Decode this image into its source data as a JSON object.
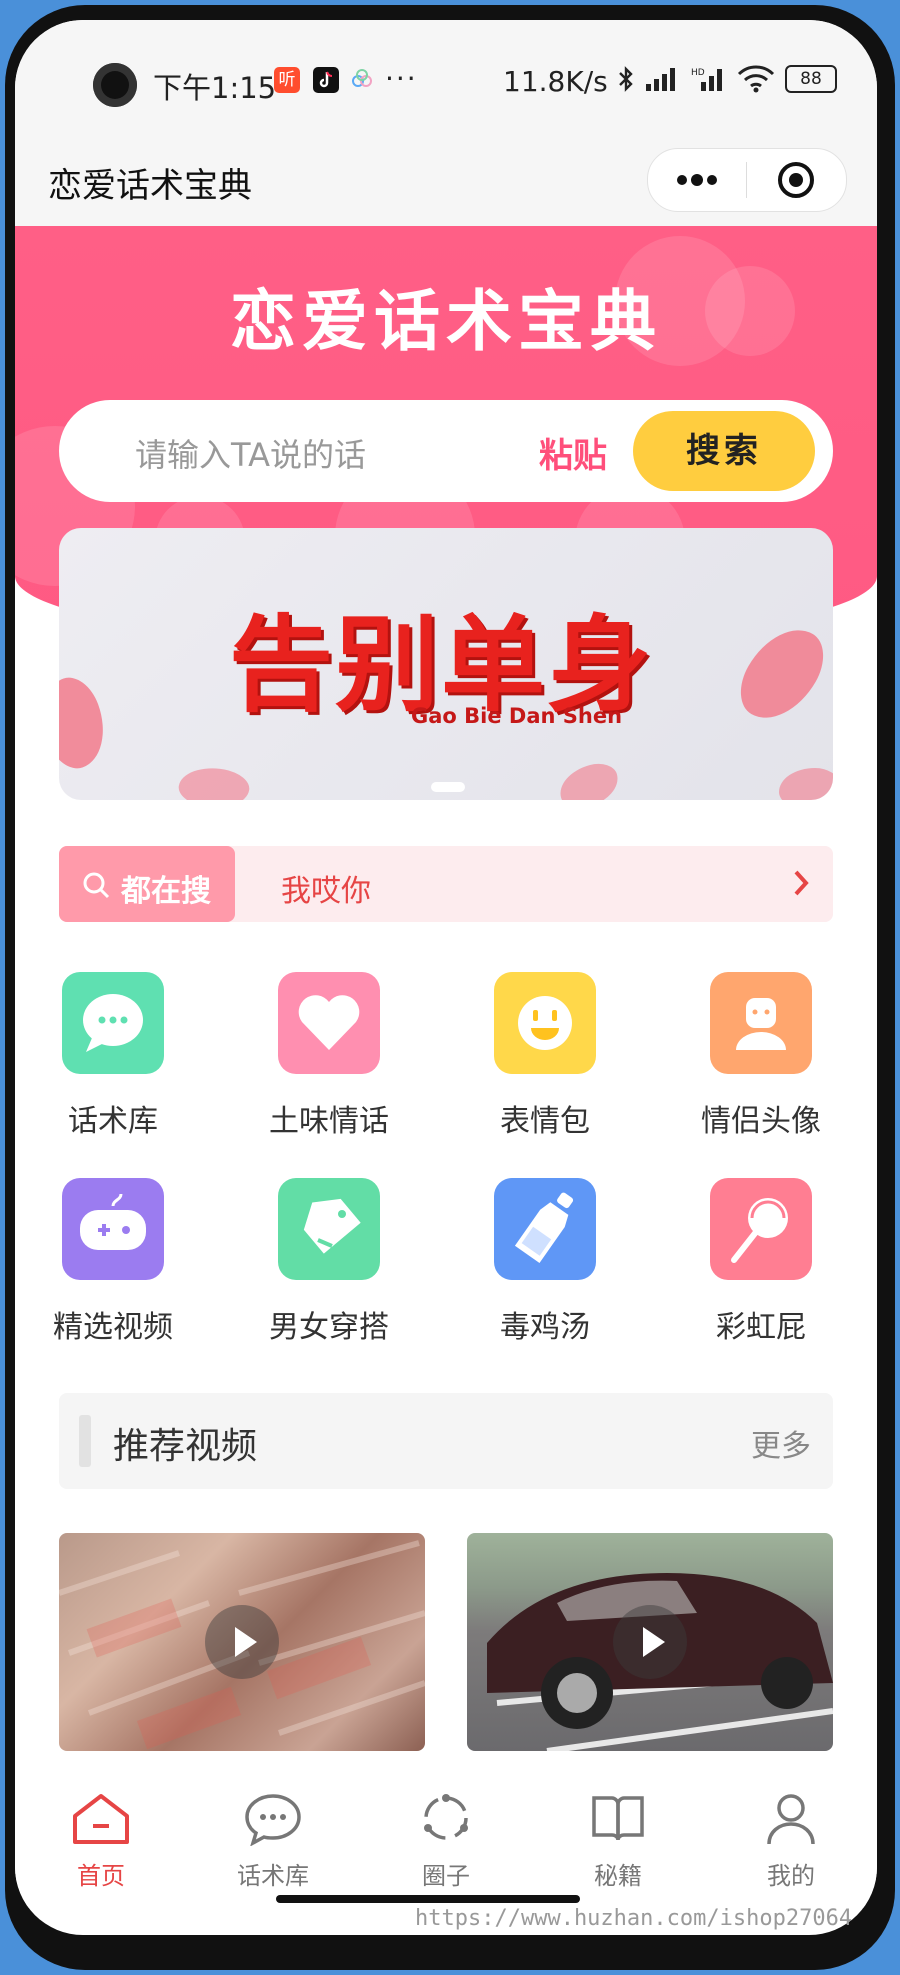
{
  "status_bar": {
    "time": "下午1:15",
    "net_speed": "11.8K/s",
    "battery": "88",
    "more": "···",
    "app_label": "听"
  },
  "navbar": {
    "title": "恋爱话术宝典"
  },
  "hero": {
    "title": "恋爱话术宝典",
    "search_placeholder": "请输入TA说的话",
    "paste_label": "粘贴",
    "search_button": "搜索"
  },
  "banner": {
    "title": "告别单身",
    "subtitle": "Gao Bie Dan Shen"
  },
  "hot_search": {
    "tag": "都在搜",
    "text": "我哎你"
  },
  "grid": [
    {
      "label": "话术库",
      "color": "#5fe0b1",
      "icon": "chat-bubble-icon"
    },
    {
      "label": "土味情话",
      "color": "#ff8fb0",
      "icon": "heart-icon"
    },
    {
      "label": "表情包",
      "color": "#ffd84a",
      "icon": "smiley-icon"
    },
    {
      "label": "情侣头像",
      "color": "#ffa66e",
      "icon": "person-icon"
    },
    {
      "label": "精选视频",
      "color": "#9b7cf0",
      "icon": "gamepad-icon"
    },
    {
      "label": "男女穿搭",
      "color": "#62dda6",
      "icon": "tag-icon"
    },
    {
      "label": "毒鸡汤",
      "color": "#5f97f6",
      "icon": "bottle-icon"
    },
    {
      "label": "彩虹屁",
      "color": "#ff7e92",
      "icon": "lollipop-icon"
    }
  ],
  "section": {
    "title": "推荐视频",
    "more": "更多"
  },
  "tabs": [
    {
      "label": "首页",
      "active": true,
      "icon": "home-icon"
    },
    {
      "label": "话术库",
      "active": false,
      "icon": "chat-icon"
    },
    {
      "label": "圈子",
      "active": false,
      "icon": "circle-icon"
    },
    {
      "label": "秘籍",
      "active": false,
      "icon": "book-icon"
    },
    {
      "label": "我的",
      "active": false,
      "icon": "user-icon"
    }
  ],
  "watermark": "https://www.huzhan.com/ishop27064",
  "colors": {
    "accent": "#ff5a83",
    "button": "#ffcd3f",
    "active_tab": "#e64545"
  }
}
